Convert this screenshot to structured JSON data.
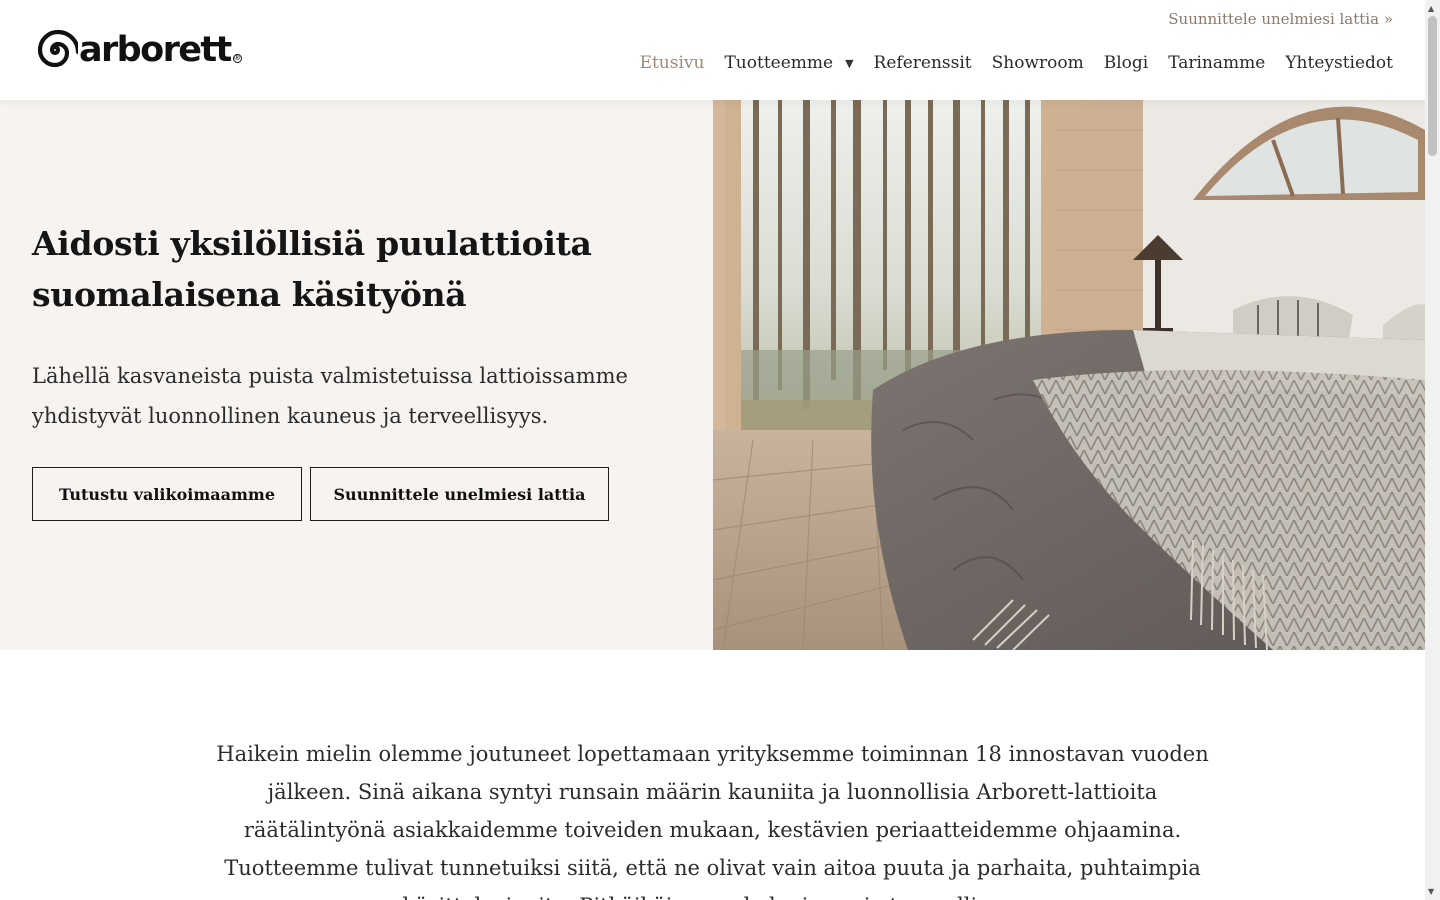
{
  "header": {
    "logo_text": "arborett",
    "logo_reg": "®",
    "top_cta": "Suunnittele unelmiesi lattia »",
    "nav": [
      {
        "label": "Etusivu",
        "active": true
      },
      {
        "label": "Tuotteemme",
        "has_dropdown": true,
        "dropdown_icon": "caret-down-icon"
      },
      {
        "label": "Referenssit"
      },
      {
        "label": "Showroom"
      },
      {
        "label": "Blogi"
      },
      {
        "label": "Tarinamme"
      },
      {
        "label": "Yhteystiedot"
      }
    ],
    "caret": "▼"
  },
  "hero": {
    "title_line1": "Aidosti yksilöllisiä puulattioita",
    "title_line2": "suomalaisena käsityönä",
    "subtitle_line1": "Lähellä kasvaneista puista valmistetuissa lattioissamme",
    "subtitle_line2": "yhdistyvät luonnollinen kauneus ja terveellisyys.",
    "button_primary": "Tutustu valikoimaamme",
    "button_secondary": "Suunnittele unelmiesi lattia",
    "image_alt": "Bedroom with wooden floor and forest view"
  },
  "intro": {
    "text": "Haikein mielin olemme joutuneet lopettamaan yrityksemme toiminnan 18 innostavan vuoden jälkeen. Sinä aikana syntyi runsain määrin kauniita ja luonnollisia Arborett-lattioita räätälintyönä asiakkaidemme toiveiden mukaan, kestävien periaatteidemme ohjaamina. Tuotteemme tulivat tunnetuiksi siitä, että ne olivat vain aitoa puuta ja parhaita, puhtaimpia käsittelyaineita. Pitkäikäisyys, ekologisuus ja terveellisyys"
  },
  "colors": {
    "accent": "#9b8a7b",
    "top_cta": "#8c7a6b",
    "hero_bg": "#f6f3f0",
    "text": "#1c1c1c"
  },
  "scrollbar": {
    "up": "▲",
    "down": "▼"
  }
}
